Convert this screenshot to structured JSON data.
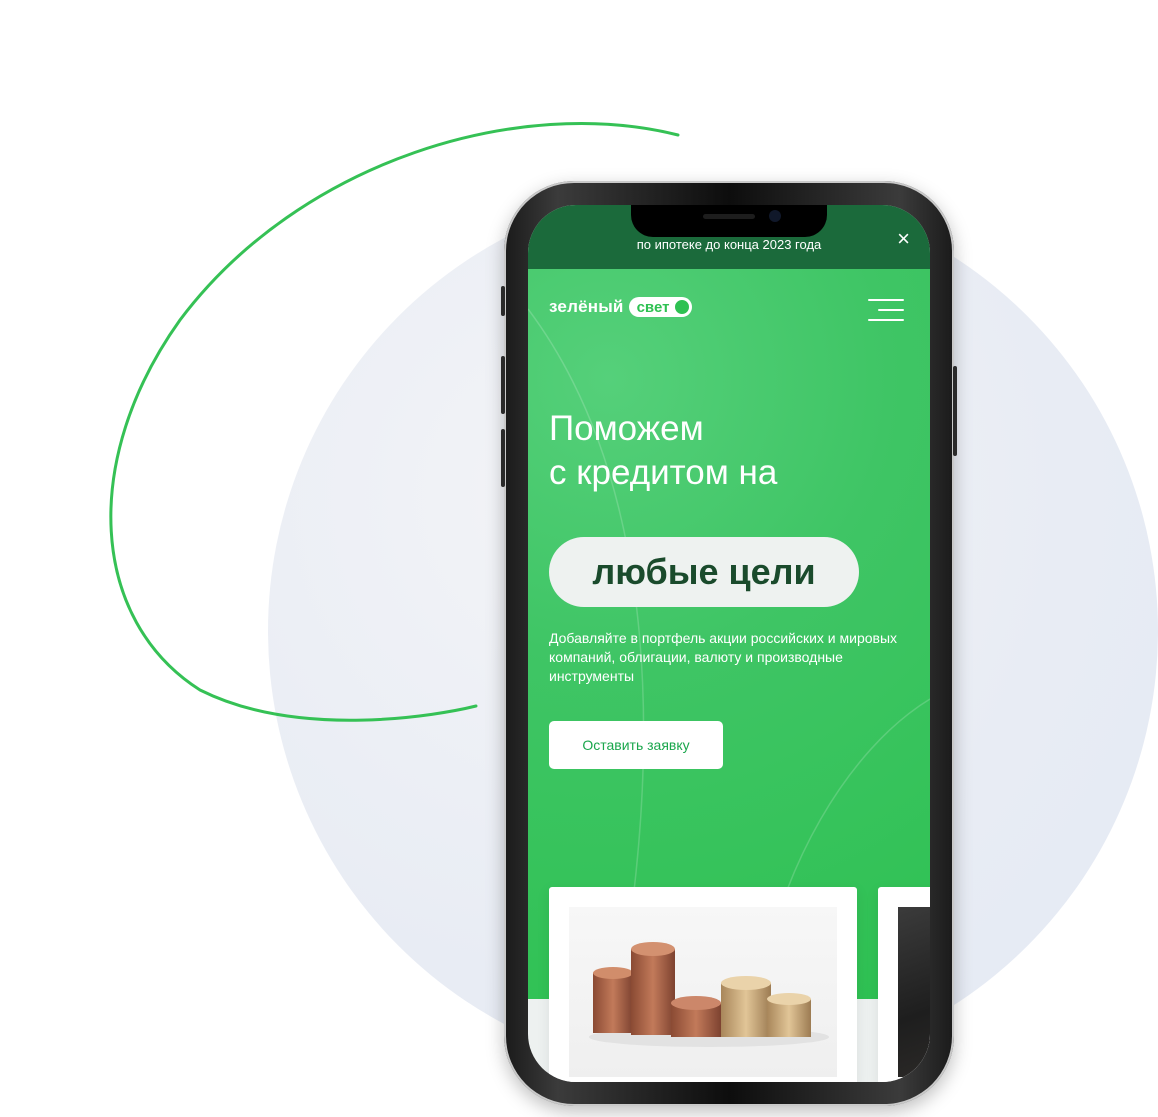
{
  "banner": {
    "text": "по ипотеке до конца 2023 года",
    "close_label": "×"
  },
  "header": {
    "logo_word": "зелёный",
    "logo_badge": "свет"
  },
  "hero": {
    "title_line1": "Поможем",
    "title_line2": "с кредитом на",
    "highlight": "любые цели",
    "description": "Добавляйте в портфель акции российских и мировых компаний, облигации, валюту и производные инструменты",
    "cta_label": "Оставить заявку"
  },
  "colors": {
    "brand_green": "#2ec152",
    "banner_green": "#1b6a3b",
    "highlight_text": "#1a4b2c",
    "background_circle": "#e8ecf4"
  },
  "icons": [
    "close-icon",
    "menu-icon",
    "logo-toggle-icon"
  ]
}
